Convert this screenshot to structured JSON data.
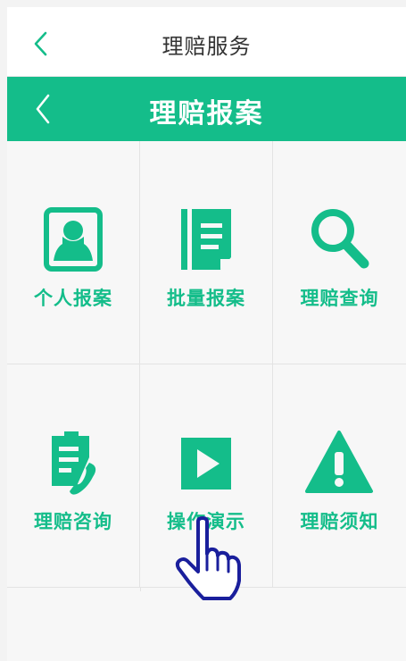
{
  "header": {
    "title": "理赔服务",
    "back_icon": "chevron-left-icon",
    "back_color": "#14bd8a"
  },
  "banner": {
    "title": "理赔报案",
    "back_icon": "chevron-left-icon",
    "background": "#14bd8a"
  },
  "menu": {
    "accent": "#14bd8a",
    "items": [
      {
        "label": "个人报案",
        "icon": "person-icon"
      },
      {
        "label": "批量报案",
        "icon": "notebook-icon"
      },
      {
        "label": "理赔查询",
        "icon": "search-icon"
      },
      {
        "label": "理赔咨询",
        "icon": "clipboard-phone-icon"
      },
      {
        "label": "操作演示",
        "icon": "play-icon"
      },
      {
        "label": "理赔须知",
        "icon": "warning-icon"
      }
    ]
  },
  "overlay": {
    "pointer_icon": "hand-pointer-icon",
    "pointer_color": "#1a1f9c"
  }
}
